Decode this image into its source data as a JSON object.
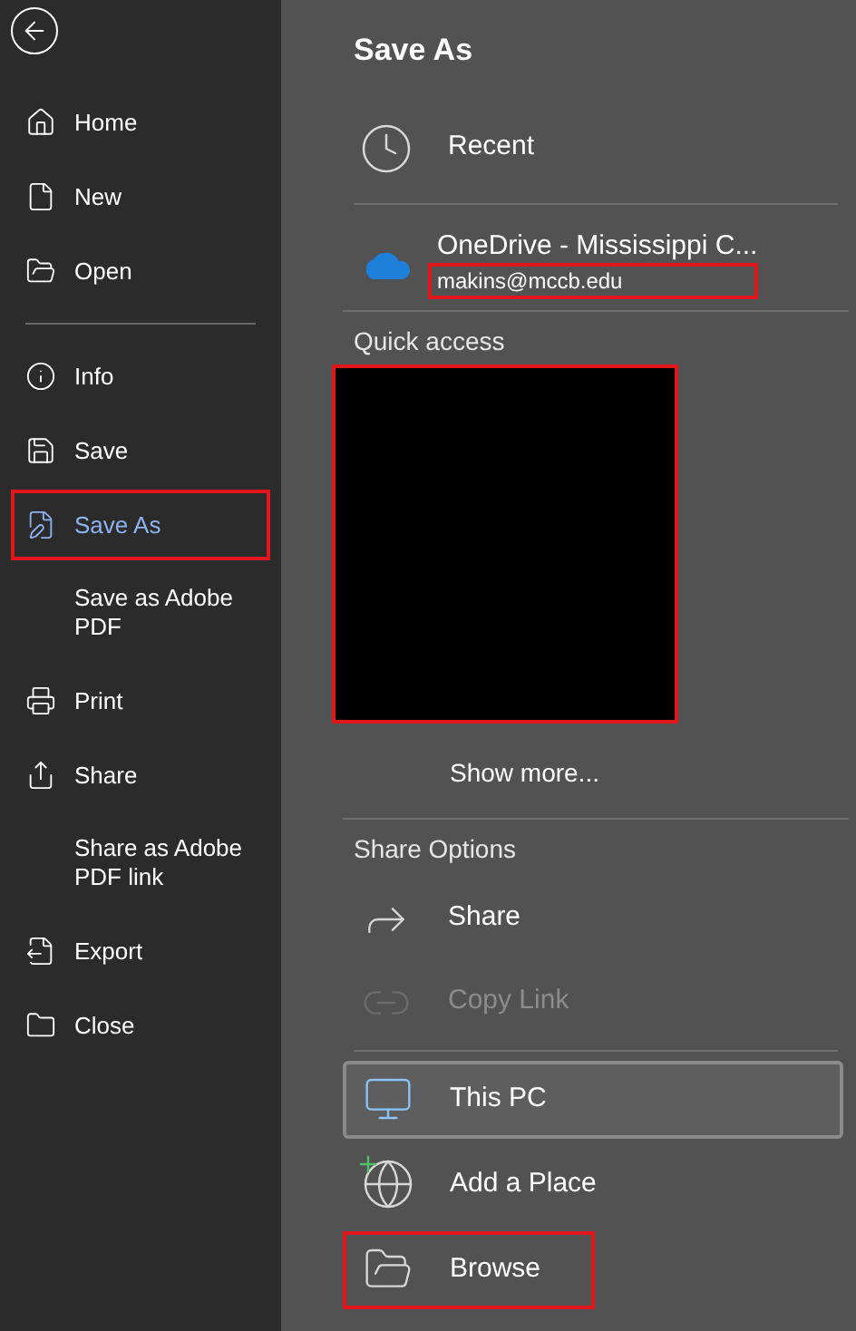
{
  "sidebar": {
    "groups": [
      [
        {
          "label": "Home",
          "selected": false,
          "annotated": false
        },
        {
          "label": "New",
          "selected": false,
          "annotated": false
        },
        {
          "label": "Open",
          "selected": false,
          "annotated": false
        }
      ],
      [
        {
          "label": "Info",
          "selected": false,
          "annotated": false
        },
        {
          "label": "Save",
          "selected": false,
          "annotated": false
        },
        {
          "label": "Save As",
          "selected": true,
          "annotated": true
        },
        {
          "label": "Save as Adobe PDF",
          "selected": false,
          "annotated": false
        },
        {
          "label": "Print",
          "selected": false,
          "annotated": false
        },
        {
          "label": "Share",
          "selected": false,
          "annotated": false
        },
        {
          "label": "Share as Adobe PDF link",
          "selected": false,
          "annotated": false
        },
        {
          "label": "Export",
          "selected": false,
          "annotated": false
        },
        {
          "label": "Close",
          "selected": false,
          "annotated": false
        }
      ]
    ]
  },
  "main": {
    "title": "Save As",
    "recent": {
      "label": "Recent"
    },
    "account": {
      "label": "OneDrive - Mississippi C...",
      "email": "makins@mccb.edu",
      "annotated": true
    },
    "quick_access": {
      "heading": "Quick access",
      "redacted": true,
      "show_more": "Show more..."
    },
    "share_options": {
      "heading": "Share Options",
      "items": [
        {
          "label": "Share",
          "disabled": false
        },
        {
          "label": "Copy Link",
          "disabled": true
        }
      ]
    },
    "places": [
      {
        "label": "This PC",
        "selected": true,
        "annotated": false
      },
      {
        "label": "Add a Place",
        "selected": false,
        "annotated": false
      },
      {
        "label": "Browse",
        "selected": false,
        "annotated": true
      }
    ]
  }
}
